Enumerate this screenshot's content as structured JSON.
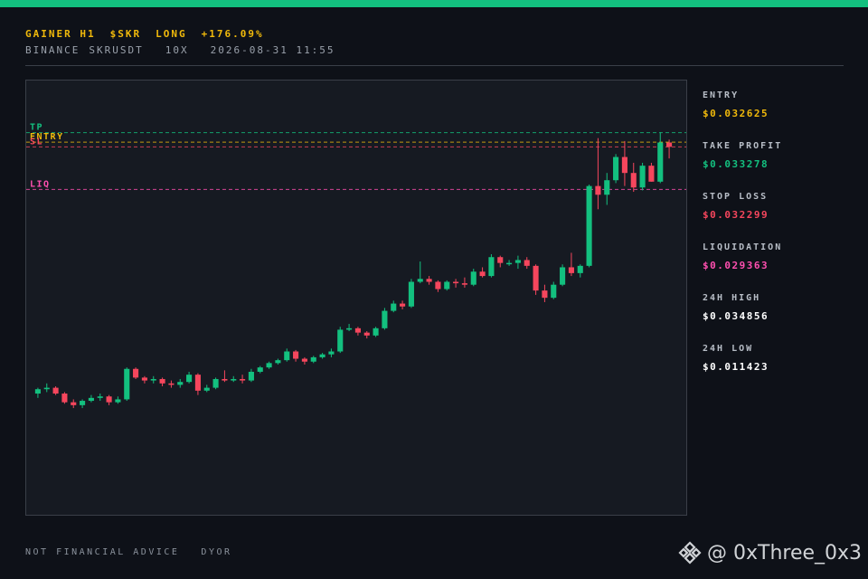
{
  "header": {
    "tag": "GAINER H1",
    "symbol": "$SKR",
    "side": "LONG",
    "change": "+176.09%",
    "exchange": "BINANCE",
    "pair": "SKRUSDT",
    "leverage": "10X",
    "datetime": "2026-08-31 11:55"
  },
  "stats": [
    {
      "label": "ENTRY",
      "value": "$0.032625",
      "color": "#f0b90b"
    },
    {
      "label": "TAKE PROFIT",
      "value": "$0.033278",
      "color": "#13c07f"
    },
    {
      "label": "STOP LOSS",
      "value": "$0.032299",
      "color": "#f6465d"
    },
    {
      "label": "LIQUIDATION",
      "value": "$0.029363",
      "color": "#ff4fb0"
    },
    {
      "label": "24H HIGH",
      "value": "$0.034856",
      "color": "#ffffff"
    },
    {
      "label": "24H LOW",
      "value": "$0.011423",
      "color": "#ffffff"
    }
  ],
  "footer": {
    "note1": "NOT FINANCIAL ADVICE",
    "note2": "DYOR"
  },
  "watermark": {
    "handle": "@ 0xThree_0x3",
    "icon": "binance-logo-icon"
  },
  "colors": {
    "accent": "#13c07f",
    "up": "#13c07f",
    "down": "#f6465d",
    "entry": "#f0b90b",
    "tp": "#13c07f",
    "sl": "#f6465d",
    "liq": "#ff4fb0"
  },
  "chart_data": {
    "type": "candlestick",
    "ylim": [
      0.011,
      0.035
    ],
    "levels": [
      {
        "name": "TP",
        "value": 0.033278,
        "color": "#13c07f"
      },
      {
        "name": "ENTRY",
        "value": 0.032625,
        "color": "#f0b90b"
      },
      {
        "name": "SL",
        "value": 0.032299,
        "color": "#f6465d"
      },
      {
        "name": "LIQ",
        "value": 0.029363,
        "color": "#ff4fb0"
      }
    ],
    "candles": [
      [
        0.0153,
        0.0157,
        0.015,
        0.0156
      ],
      [
        0.0156,
        0.016,
        0.0154,
        0.0157
      ],
      [
        0.0157,
        0.0158,
        0.0152,
        0.0153
      ],
      [
        0.0153,
        0.0154,
        0.0146,
        0.0147
      ],
      [
        0.0147,
        0.0149,
        0.0143,
        0.0145
      ],
      [
        0.0145,
        0.0149,
        0.0143,
        0.0148
      ],
      [
        0.0148,
        0.0152,
        0.0147,
        0.015
      ],
      [
        0.015,
        0.0153,
        0.0148,
        0.0151
      ],
      [
        0.0151,
        0.0152,
        0.0145,
        0.0147
      ],
      [
        0.0147,
        0.0151,
        0.0146,
        0.0149
      ],
      [
        0.0149,
        0.0171,
        0.0148,
        0.017
      ],
      [
        0.017,
        0.0171,
        0.0163,
        0.0164
      ],
      [
        0.0164,
        0.0165,
        0.016,
        0.0162
      ],
      [
        0.0162,
        0.0165,
        0.016,
        0.0163
      ],
      [
        0.0163,
        0.0164,
        0.0158,
        0.016
      ],
      [
        0.016,
        0.0162,
        0.0157,
        0.0159
      ],
      [
        0.0159,
        0.0163,
        0.0157,
        0.0161
      ],
      [
        0.0161,
        0.0168,
        0.016,
        0.0166
      ],
      [
        0.0166,
        0.0167,
        0.0152,
        0.0155
      ],
      [
        0.0155,
        0.0159,
        0.0154,
        0.0157
      ],
      [
        0.0157,
        0.0164,
        0.0156,
        0.0163
      ],
      [
        0.0163,
        0.0169,
        0.0161,
        0.0162
      ],
      [
        0.0162,
        0.0165,
        0.0161,
        0.0163
      ],
      [
        0.0163,
        0.0166,
        0.016,
        0.0162
      ],
      [
        0.0162,
        0.017,
        0.0161,
        0.0168
      ],
      [
        0.0168,
        0.0172,
        0.0167,
        0.0171
      ],
      [
        0.0171,
        0.0175,
        0.017,
        0.0174
      ],
      [
        0.0174,
        0.0177,
        0.0173,
        0.0176
      ],
      [
        0.0176,
        0.0184,
        0.0175,
        0.0182
      ],
      [
        0.0182,
        0.0183,
        0.0175,
        0.0177
      ],
      [
        0.0177,
        0.0178,
        0.0173,
        0.0175
      ],
      [
        0.0175,
        0.0179,
        0.0174,
        0.0178
      ],
      [
        0.0178,
        0.0181,
        0.0177,
        0.018
      ],
      [
        0.018,
        0.0184,
        0.0178,
        0.0182
      ],
      [
        0.0182,
        0.0199,
        0.0181,
        0.0197
      ],
      [
        0.0197,
        0.0201,
        0.0196,
        0.0198
      ],
      [
        0.0198,
        0.0199,
        0.0193,
        0.0195
      ],
      [
        0.0195,
        0.0196,
        0.0191,
        0.0193
      ],
      [
        0.0193,
        0.0199,
        0.0192,
        0.0198
      ],
      [
        0.0198,
        0.0212,
        0.0197,
        0.021
      ],
      [
        0.021,
        0.0217,
        0.0209,
        0.0215
      ],
      [
        0.0215,
        0.0217,
        0.0211,
        0.0213
      ],
      [
        0.0213,
        0.0232,
        0.0212,
        0.023
      ],
      [
        0.023,
        0.0244,
        0.0229,
        0.0232
      ],
      [
        0.0232,
        0.0234,
        0.0228,
        0.023
      ],
      [
        0.023,
        0.0231,
        0.0223,
        0.0225
      ],
      [
        0.0225,
        0.0231,
        0.0224,
        0.023
      ],
      [
        0.023,
        0.0232,
        0.0226,
        0.0229
      ],
      [
        0.0229,
        0.0233,
        0.0226,
        0.0228
      ],
      [
        0.0228,
        0.0239,
        0.0227,
        0.0237
      ],
      [
        0.0237,
        0.024,
        0.0233,
        0.0234
      ],
      [
        0.0234,
        0.0249,
        0.0233,
        0.0247
      ],
      [
        0.0247,
        0.0248,
        0.024,
        0.0243
      ],
      [
        0.0243,
        0.0245,
        0.0241,
        0.0243
      ],
      [
        0.0243,
        0.0248,
        0.0239,
        0.0245
      ],
      [
        0.0245,
        0.0247,
        0.0239,
        0.0241
      ],
      [
        0.0241,
        0.0242,
        0.0221,
        0.0224
      ],
      [
        0.0224,
        0.0228,
        0.0216,
        0.0219
      ],
      [
        0.0219,
        0.023,
        0.0218,
        0.0228
      ],
      [
        0.0228,
        0.0242,
        0.0227,
        0.024
      ],
      [
        0.024,
        0.025,
        0.0234,
        0.0236
      ],
      [
        0.0236,
        0.0242,
        0.0233,
        0.0241
      ],
      [
        0.0241,
        0.0297,
        0.024,
        0.0296
      ],
      [
        0.0296,
        0.0329,
        0.028,
        0.029
      ],
      [
        0.029,
        0.0305,
        0.0283,
        0.03
      ],
      [
        0.03,
        0.0318,
        0.0298,
        0.0316
      ],
      [
        0.0316,
        0.0327,
        0.0296,
        0.0305
      ],
      [
        0.0305,
        0.0312,
        0.0292,
        0.0295
      ],
      [
        0.0295,
        0.0312,
        0.0293,
        0.031
      ],
      [
        0.031,
        0.0312,
        0.0299,
        0.0299
      ],
      [
        0.0299,
        0.0333,
        0.0298,
        0.0326
      ],
      [
        0.0326,
        0.0328,
        0.0315,
        0.0323
      ]
    ]
  }
}
